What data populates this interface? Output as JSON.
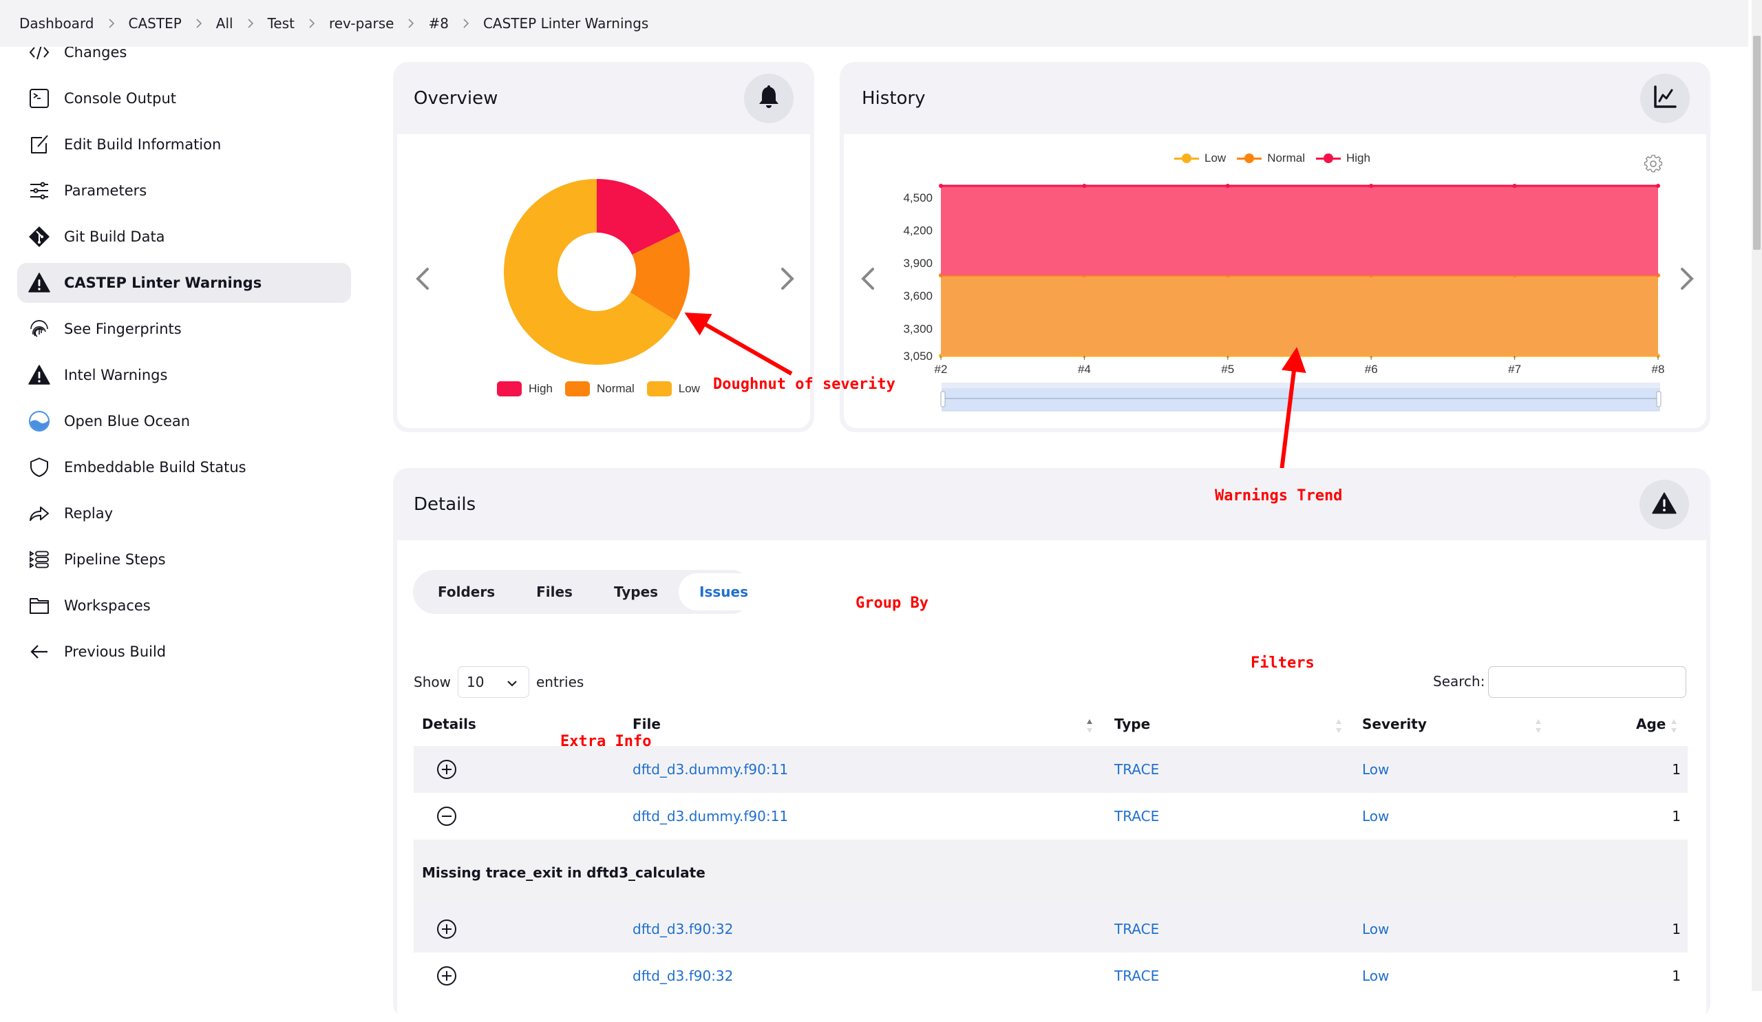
{
  "breadcrumb": [
    "Dashboard",
    "CASTEP",
    "All",
    "Test",
    "rev-parse",
    "#8",
    "CASTEP Linter Warnings"
  ],
  "sidebar": {
    "items": [
      {
        "label": "Changes",
        "icon": "code-icon",
        "active": false
      },
      {
        "label": "Console Output",
        "icon": "terminal-icon",
        "active": false
      },
      {
        "label": "Edit Build Information",
        "icon": "edit-icon",
        "active": false
      },
      {
        "label": "Parameters",
        "icon": "sliders-icon",
        "active": false
      },
      {
        "label": "Git Build Data",
        "icon": "git-icon",
        "active": false
      },
      {
        "label": "CASTEP Linter Warnings",
        "icon": "warning-icon",
        "active": true
      },
      {
        "label": "See Fingerprints",
        "icon": "fingerprint-icon",
        "active": false
      },
      {
        "label": "Intel Warnings",
        "icon": "warning-icon",
        "active": false
      },
      {
        "label": "Open Blue Ocean",
        "icon": "blue-ocean-icon",
        "active": false
      },
      {
        "label": "Embeddable Build Status",
        "icon": "shield-icon",
        "active": false
      },
      {
        "label": "Replay",
        "icon": "replay-icon",
        "active": false
      },
      {
        "label": "Pipeline Steps",
        "icon": "pipeline-steps-icon",
        "active": false
      },
      {
        "label": "Workspaces",
        "icon": "folder-icon",
        "active": false
      },
      {
        "label": "Previous Build",
        "icon": "arrow-left-icon",
        "active": false
      }
    ]
  },
  "overview": {
    "title": "Overview",
    "icon": "bell-icon"
  },
  "history": {
    "title": "History",
    "icon": "line-chart-icon"
  },
  "details": {
    "title": "Details",
    "icon": "warning-icon",
    "tabs": [
      {
        "label": "Folders",
        "active": false
      },
      {
        "label": "Files",
        "active": false
      },
      {
        "label": "Types",
        "active": false
      },
      {
        "label": "Issues",
        "active": true
      }
    ],
    "show_label": "Show",
    "entries_value": "10",
    "entries_label": "entries",
    "search_label": "Search:",
    "search_value": "",
    "columns": [
      "Details",
      "File",
      "Type",
      "Severity",
      "Age"
    ],
    "rows": [
      {
        "toggle": "expand",
        "file": "dftd_d3.dummy.f90:11",
        "type": "TRACE",
        "severity": "Low",
        "age": "1"
      },
      {
        "toggle": "collapse",
        "file": "dftd_d3.dummy.f90:11",
        "type": "TRACE",
        "severity": "Low",
        "age": "1"
      },
      {
        "toggle": "expand",
        "file": "dftd_d3.f90:32",
        "type": "TRACE",
        "severity": "Low",
        "age": "1"
      },
      {
        "toggle": "expand",
        "file": "dftd_d3.f90:32",
        "type": "TRACE",
        "severity": "Low",
        "age": "1"
      }
    ],
    "expanded_detail": "Missing trace_exit in dftd3_calculate"
  },
  "annotations": {
    "doughnut": "Doughnut of severity",
    "trend": "Warnings Trend",
    "group_by": "Group By",
    "filters": "Filters",
    "extra_info": "Extra Info"
  },
  "colors": {
    "high": "#f5114a",
    "normal": "#fb830e",
    "low": "#fbb01c",
    "link": "#1f6fd0",
    "annotation": "#ff0000"
  },
  "chart_data": [
    {
      "type": "pie",
      "title": "Overview",
      "variant": "doughnut",
      "categories": [
        "High",
        "Normal",
        "Low"
      ],
      "values": [
        820,
        736,
        3050
      ],
      "colors": [
        "#f5114a",
        "#fb830e",
        "#fbb01c"
      ],
      "legend": "bottom"
    },
    {
      "type": "area",
      "title": "History",
      "stacked": true,
      "categories": [
        "#2",
        "#4",
        "#5",
        "#6",
        "#7",
        "#8"
      ],
      "series": [
        {
          "name": "Low",
          "values": [
            3050,
            3050,
            3050,
            3050,
            3050,
            3050
          ],
          "color": "#fbb01c"
        },
        {
          "name": "Normal",
          "values": [
            736,
            736,
            736,
            736,
            736,
            736
          ],
          "color": "#fb830e"
        },
        {
          "name": "High",
          "values": [
            820,
            820,
            820,
            820,
            820,
            820
          ],
          "color": "#f5114a"
        }
      ],
      "yticks": [
        "3,050",
        "3,300",
        "3,600",
        "3,900",
        "4,200",
        "4,500"
      ],
      "ylim": [
        3050,
        4606
      ],
      "legend": "top",
      "xlabel": "",
      "ylabel": ""
    }
  ]
}
